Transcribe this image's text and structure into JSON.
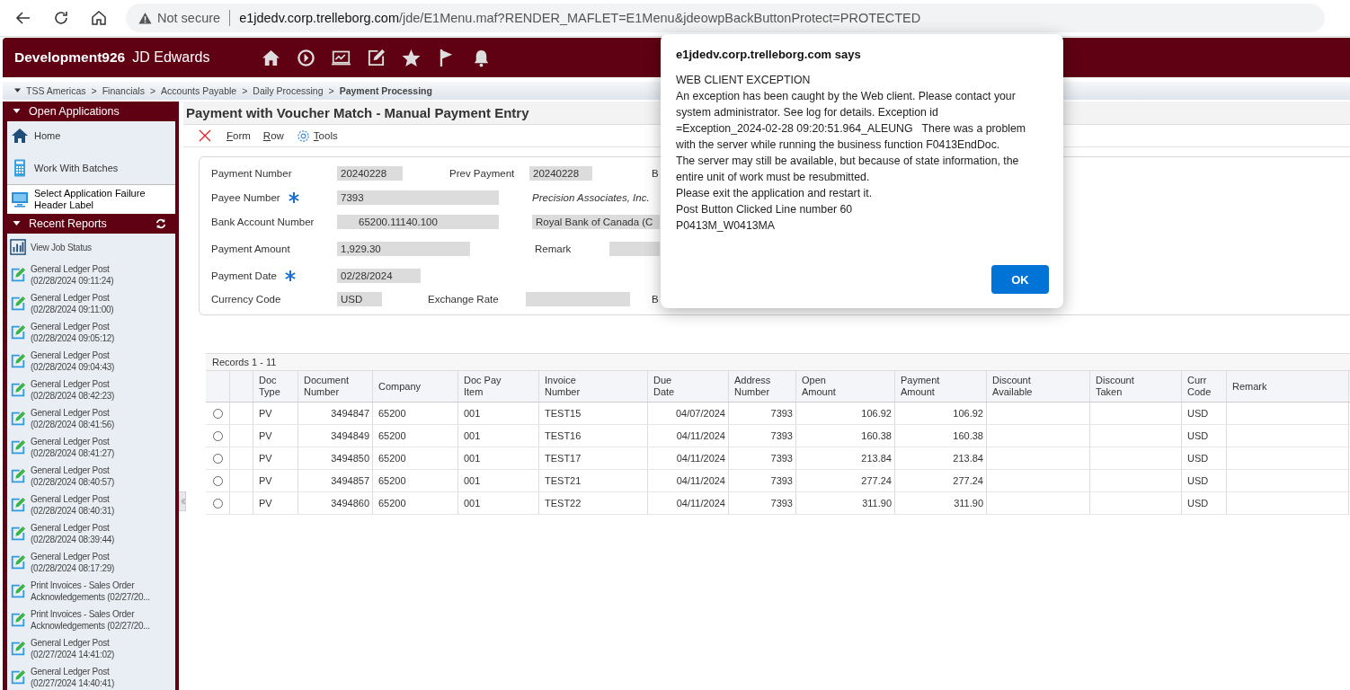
{
  "browser": {
    "security": "Not secure",
    "url_host": "e1jdedv.corp.trelleborg.com",
    "url_path": "/jde/E1Menu.maf?RENDER_MAFLET=E1Menu&jdeowpBackButtonProtect=PROTECTED"
  },
  "header": {
    "environment": "Development926",
    "product": "JD Edwards"
  },
  "breadcrumb": [
    {
      "label": "TSS Americas"
    },
    {
      "separator": ">",
      "label": "Financials"
    },
    {
      "separator": ">",
      "label": "Accounts Payable"
    },
    {
      "separator": ">",
      "label": "Daily Processing"
    },
    {
      "separator": ">",
      "label": "Payment Processing"
    }
  ],
  "sidebar": {
    "open_title": "Open Applications",
    "open_items": [
      {
        "kind": "home",
        "label": "Home",
        "selected": false
      },
      {
        "kind": "batches",
        "label": "Work With Batches",
        "selected": false
      },
      {
        "kind": "application",
        "label": "Select Application Failure Header Label",
        "selected": true
      }
    ],
    "reports_title": "Recent Reports",
    "report_items": [
      {
        "kind": "job_status",
        "label": "View Job Status"
      },
      {
        "kind": "report",
        "label": "General Ledger Post",
        "detail": "(02/28/2024 09:11:24)"
      },
      {
        "kind": "report",
        "label": "General Ledger Post",
        "detail": "(02/28/2024 09:11:00)"
      },
      {
        "kind": "report",
        "label": "General Ledger Post",
        "detail": "(02/28/2024 09:05:12)"
      },
      {
        "kind": "report",
        "label": "General Ledger Post",
        "detail": "(02/28/2024 09:04:43)"
      },
      {
        "kind": "report",
        "label": "General Ledger Post",
        "detail": "(02/28/2024 08:42:23)"
      },
      {
        "kind": "report",
        "label": "General Ledger Post",
        "detail": "(02/28/2024 08:41:56)"
      },
      {
        "kind": "report",
        "label": "General Ledger Post",
        "detail": "(02/28/2024 08:41:27)"
      },
      {
        "kind": "report",
        "label": "General Ledger Post",
        "detail": "(02/28/2024 08:40:57)"
      },
      {
        "kind": "report",
        "label": "General Ledger Post",
        "detail": "(02/28/2024 08:40:31)"
      },
      {
        "kind": "report",
        "label": "General Ledger Post",
        "detail": "(02/28/2024 08:39:44)"
      },
      {
        "kind": "report",
        "label": "General Ledger Post",
        "detail": "(02/28/2024 08:17:29)"
      },
      {
        "kind": "report",
        "label": "Print Invoices - Sales Order",
        "detail": "Acknowledgements (02/27/20..."
      },
      {
        "kind": "report",
        "label": "Print Invoices - Sales Order",
        "detail": "Acknowledgements (02/27/20..."
      },
      {
        "kind": "report",
        "label": "General Ledger Post",
        "detail": "(02/27/2024 14:41:02)"
      },
      {
        "kind": "report",
        "label": "General Ledger Post",
        "detail": "(02/27/2024 14:40:41)"
      }
    ]
  },
  "form": {
    "title": "Payment with Voucher Match - Manual Payment Entry",
    "menu": [
      "Form",
      "Row",
      "Tools"
    ],
    "rows": [
      [
        {
          "kind": "label",
          "text": "Payment Number"
        },
        {
          "kind": "field",
          "value": "20240228"
        },
        {
          "kind": "label",
          "text": "Prev Payment"
        },
        {
          "kind": "field",
          "value": "20240228"
        },
        {
          "kind": "label",
          "text": "B"
        }
      ],
      [
        {
          "kind": "label",
          "text": "Payee Number",
          "required": true
        },
        {
          "kind": "field",
          "value": "7393"
        },
        {
          "kind": "text",
          "text": "Precision Associates, Inc."
        }
      ],
      [
        {
          "kind": "label",
          "text": "Bank Account Number"
        },
        {
          "kind": "field",
          "value": "65200.11140.100"
        },
        {
          "kind": "field",
          "value": "Royal Bank of Canada (C"
        }
      ],
      [
        {
          "kind": "label",
          "text": "Payment Amount"
        },
        {
          "kind": "field",
          "value": "1,929.30"
        },
        {
          "kind": "label",
          "text": "Remark"
        },
        {
          "kind": "field"
        }
      ],
      [
        {
          "kind": "label",
          "text": "Payment Date",
          "required": true
        },
        {
          "kind": "field",
          "value": "02/28/2024"
        }
      ],
      [
        {
          "kind": "label",
          "text": "Currency Code"
        },
        {
          "kind": "field",
          "value": "USD"
        },
        {
          "kind": "label",
          "text": "Exchange Rate"
        },
        {
          "kind": "field"
        },
        {
          "kind": "label",
          "text": "B"
        }
      ]
    ]
  },
  "grid": {
    "records": "Records 1 - 11",
    "columns": [
      {
        "label": "Doc Type",
        "kind": "text"
      },
      {
        "label": "Document Number",
        "kind": "number"
      },
      {
        "label": "Company",
        "kind": "text"
      },
      {
        "label": "Doc Pay Item",
        "kind": "text"
      },
      {
        "label": "Invoice Number",
        "kind": "text"
      },
      {
        "label": "Due Date",
        "kind": "number"
      },
      {
        "label": "Address Number",
        "kind": "number"
      },
      {
        "label": "Open Amount",
        "kind": "number"
      },
      {
        "label": "Payment Amount",
        "kind": "number"
      },
      {
        "label": "Discount Available",
        "kind": "number"
      },
      {
        "label": "Discount Taken",
        "kind": "number"
      },
      {
        "label": "Curr Code",
        "kind": "text"
      },
      {
        "label": "Remark",
        "kind": "text"
      }
    ],
    "rows": [
      {
        "selected": false,
        "cells": [
          "PV",
          "3494847",
          "65200",
          "001",
          "TEST15",
          "04/07/2024",
          "7393",
          "106.92",
          "106.92",
          null,
          null,
          "USD",
          null
        ]
      },
      {
        "selected": false,
        "cells": [
          "PV",
          "3494849",
          "65200",
          "001",
          "TEST16",
          "04/11/2024",
          "7393",
          "160.38",
          "160.38",
          null,
          null,
          "USD",
          null
        ]
      },
      {
        "selected": false,
        "cells": [
          "PV",
          "3494850",
          "65200",
          "001",
          "TEST17",
          "04/11/2024",
          "7393",
          "213.84",
          "213.84",
          null,
          null,
          "USD",
          null
        ]
      },
      {
        "selected": false,
        "cells": [
          "PV",
          "3494857",
          "65200",
          "001",
          "TEST21",
          "04/11/2024",
          "7393",
          "277.24",
          "277.24",
          null,
          null,
          "USD",
          null
        ]
      },
      {
        "selected": false,
        "cells": [
          "PV",
          "3494860",
          "65200",
          "001",
          "TEST22",
          "04/11/2024",
          "7393",
          "311.90",
          "311.90",
          null,
          null,
          "USD",
          null
        ]
      }
    ]
  },
  "dialog": {
    "title": "e1jdedv.corp.trelleborg.com says",
    "lines": [
      "WEB CLIENT EXCEPTION",
      "An exception has been caught by the Web client. Please contact your",
      "system administrator. See log for details. Exception id",
      "=Exception_2024-02-28 09:20:51.964_ALEUNG   There was a problem",
      "with the server while running the business function F0413EndDoc.",
      "The server may still be available, but because of state information, the",
      "entire unit of work must be resubmitted.",
      "Please exit the application and restart it.",
      "Post Button Clicked Line number 60",
      "P0413M_W0413MA"
    ],
    "button": "OK"
  }
}
